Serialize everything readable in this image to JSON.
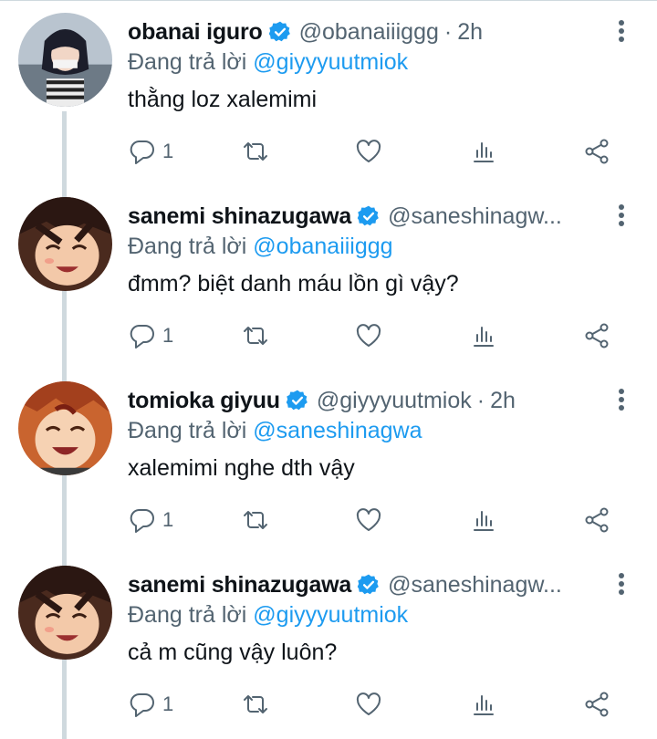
{
  "reply_prefix": "Đang trả lời",
  "tweets": [
    {
      "name": "obanai iguro",
      "handle": "@obanaiiiggg",
      "separator": "·",
      "time": "2h",
      "reply_to": "@giyyyuutmiok",
      "text": "thằng loz xalemimi",
      "reply_count": "1",
      "avatar_icon": "avatar-obanai"
    },
    {
      "name": "sanemi shinazugawa",
      "handle": "@saneshinagw...",
      "separator": "",
      "time": "",
      "reply_to": "@obanaiiiggg",
      "text": "đmm? biệt danh máu lồn gì vậy?",
      "reply_count": "1",
      "avatar_icon": "avatar-sanemi"
    },
    {
      "name": "tomioka giyuu",
      "handle": "@giyyyuutmiok",
      "separator": "·",
      "time": "2h",
      "reply_to": "@saneshinagwa",
      "text": "xalemimi nghe dth vậy",
      "reply_count": "1",
      "avatar_icon": "avatar-tomioka"
    },
    {
      "name": "sanemi shinazugawa",
      "handle": "@saneshinagw...",
      "separator": "",
      "time": "",
      "reply_to": "@giyyyuutmiok",
      "text": "cả m cũng vậy luôn?",
      "reply_count": "1",
      "avatar_icon": "avatar-sanemi"
    }
  ],
  "colors": {
    "accent": "#1d9bf0",
    "secondary_text": "#536471",
    "primary_text": "#0f1419",
    "thread_line": "#cfd9de"
  }
}
